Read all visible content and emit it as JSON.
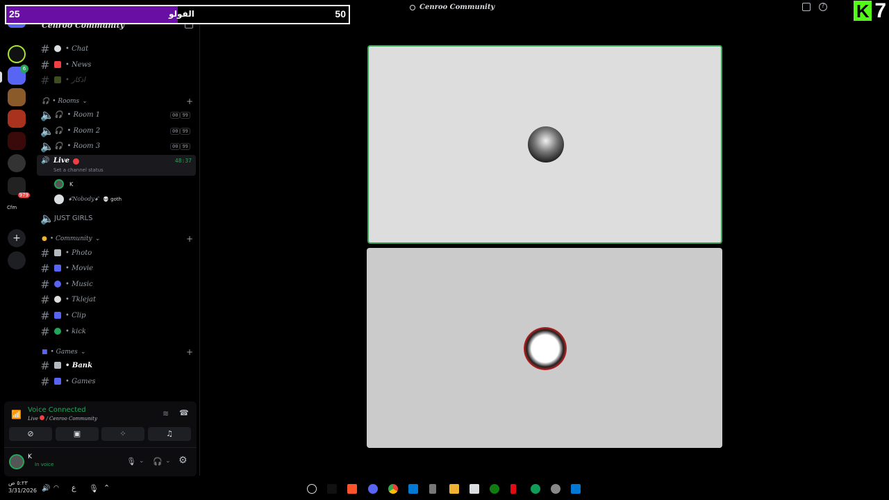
{
  "overlay": {
    "left_count": "25",
    "label": "الفولو",
    "right_count": "50",
    "progress_fraction": 0.5,
    "fill_color": "#6a0fa3"
  },
  "window": {
    "title": "Cenroo Community",
    "icons": [
      "inbox-icon",
      "help-icon"
    ]
  },
  "brand": {
    "logo_letter": "K",
    "logo_number": "7",
    "logo_color": "#53fc18"
  },
  "server": {
    "name": "Cenroo Community",
    "add_member_icon": "add-member-icon"
  },
  "channels": {
    "text_top": [
      {
        "name": "• Chat",
        "icon": "speech-bubble"
      },
      {
        "name": "• News",
        "icon": "loudspeaker"
      },
      {
        "name": "• اذكار",
        "icon": "leaf"
      }
    ],
    "rooms_category": "• Rooms",
    "rooms": [
      {
        "name": "• Room 1",
        "left_count": "00",
        "right_count": "99"
      },
      {
        "name": "• Room 2",
        "left_count": "00",
        "right_count": "99"
      },
      {
        "name": "• Room 3",
        "left_count": "00",
        "right_count": "99"
      }
    ],
    "live": {
      "name": "Live",
      "status_placeholder": "Set a channel status",
      "timer": "48:37",
      "members": [
        {
          "name": "K"
        },
        {
          "name": "ꗃNobodyꗃ",
          "tag": "💀 goth"
        }
      ]
    },
    "just_girls": "JUST GIRLS",
    "community_category": "• Community",
    "community": [
      {
        "name": "• Photo"
      },
      {
        "name": "• Movie"
      },
      {
        "name": "• Music"
      },
      {
        "name": "• Tklejat"
      },
      {
        "name": "• Clip"
      },
      {
        "name": "• kick"
      }
    ],
    "games_category": "• Games",
    "games": [
      {
        "name": "• Bank"
      },
      {
        "name": "• Games"
      }
    ]
  },
  "voice_panel": {
    "status": "Voice Connected",
    "location_channel": "Live",
    "location_server": "/ Cenroo Community",
    "buttons": [
      "camera-off-icon",
      "screen-share-icon",
      "activities-icon",
      "soundboard-icon"
    ]
  },
  "user_panel": {
    "username": "K",
    "status": "In voice"
  },
  "rail": {
    "unread_badge": "979",
    "cfm_label": "Cfm",
    "green_badge": "6"
  },
  "taskbar": {
    "time": "٥:٢٣ ص",
    "date": "3/31/2026",
    "lang": "ع"
  },
  "colors": {
    "speaking_ring": "#3ba55c",
    "tile_top": "#dddddd",
    "tile_bottom": "#cbcbcb",
    "live_icon": "#f23f43"
  }
}
